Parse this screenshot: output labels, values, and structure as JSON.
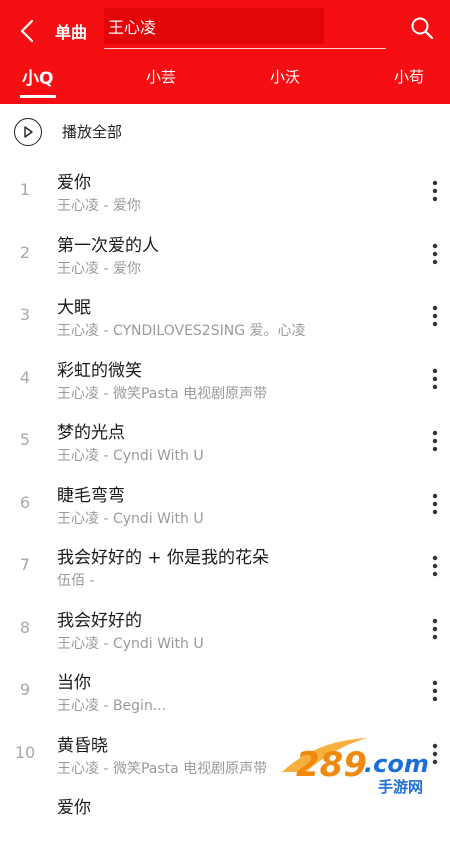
{
  "header": {
    "category_label": "单曲",
    "search_value": "王心凌",
    "accent_color": "#f50f12",
    "icons": {
      "back": "back-arrow-icon",
      "delete": "trash-icon",
      "search": "search-icon"
    }
  },
  "tabs": [
    {
      "label": "小Q",
      "active": true
    },
    {
      "label": "小芸",
      "active": false
    },
    {
      "label": "小沃",
      "active": false
    },
    {
      "label": "小苟",
      "active": false
    }
  ],
  "play_all": {
    "label": "播放全部",
    "icon": "play-circle-icon"
  },
  "songs": [
    {
      "index": "1",
      "title": "爱你",
      "subtitle": "王心凌 - 爱你"
    },
    {
      "index": "2",
      "title": "第一次爱的人",
      "subtitle": "王心凌 - 爱你"
    },
    {
      "index": "3",
      "title": "大眠",
      "subtitle": "王心凌 - CYNDILOVES2SING 爱。心凌"
    },
    {
      "index": "4",
      "title": "彩虹的微笑",
      "subtitle": "王心凌 - 微笑Pasta 电视剧原声带"
    },
    {
      "index": "5",
      "title": "梦的光点",
      "subtitle": "王心凌 - Cyndi With U"
    },
    {
      "index": "6",
      "title": "睫毛弯弯",
      "subtitle": "王心凌 - Cyndi With U"
    },
    {
      "index": "7",
      "title": "我会好好的 + 你是我的花朵",
      "subtitle": "伍佰 -"
    },
    {
      "index": "8",
      "title": "我会好好的",
      "subtitle": "王心凌 - Cyndi With U"
    },
    {
      "index": "9",
      "title": "当你",
      "subtitle": "王心凌 - Begin..."
    },
    {
      "index": "10",
      "title": "黄昏晓",
      "subtitle": "王心凌 - 微笑Pasta 电视剧原声带"
    },
    {
      "index": "",
      "title": "爱你",
      "subtitle": ""
    }
  ],
  "more_icon": "more-vertical-icon",
  "watermark": {
    "logo_text": "289.com",
    "sub_text": "手游网"
  }
}
